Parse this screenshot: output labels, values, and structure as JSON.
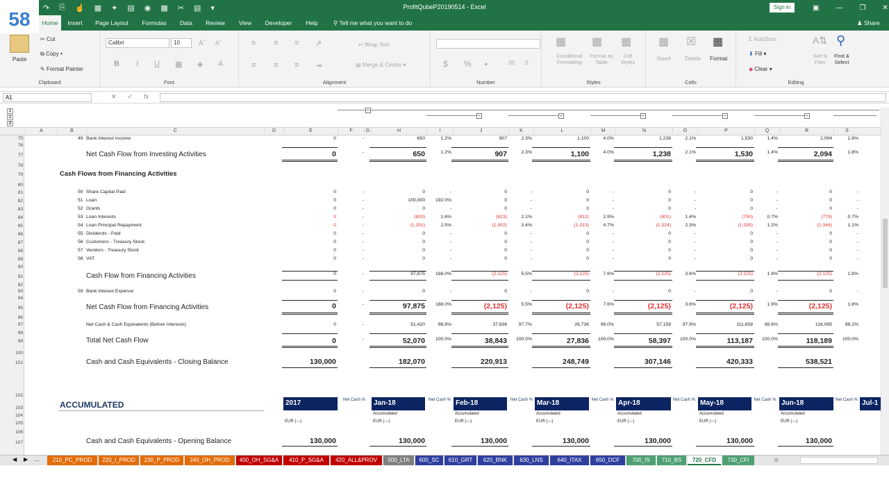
{
  "window": {
    "title": "ProfitQubeP20190514 - Excel",
    "signin": "Sign in",
    "share": "Share",
    "badge": "58"
  },
  "menu_tabs": [
    "Home",
    "Insert",
    "Page Layout",
    "Formulas",
    "Data",
    "Review",
    "View",
    "Developer",
    "Help"
  ],
  "tell_me": "Tell me what you want to do",
  "ribbon": {
    "clipboard": {
      "label": "Clipboard",
      "paste": "Paste",
      "cut": "Cut",
      "copy": "Copy",
      "format_painter": "Format Painter"
    },
    "font": {
      "label": "Font",
      "family": "Calibri",
      "size": "10"
    },
    "alignment": {
      "label": "Alignment",
      "wrap": "Wrap Text",
      "merge": "Merge & Center"
    },
    "number": {
      "label": "Number"
    },
    "styles": {
      "label": "Styles",
      "conditional": "Conditional Formatting",
      "format_table": "Format as Table",
      "cell_styles": "Cell Styles"
    },
    "cells": {
      "label": "Cells",
      "insert": "Insert",
      "delete": "Delete",
      "format": "Format"
    },
    "editing": {
      "label": "Editing",
      "autosum": "AutoSum",
      "fill": "Fill",
      "clear": "Clear",
      "sort": "Sort & Filter",
      "find": "Find & Select"
    }
  },
  "namebox": "A1",
  "columns": [
    "A",
    "B",
    "C",
    "D",
    "E",
    "F",
    "G",
    "H",
    "I",
    "J",
    "K",
    "L",
    "M",
    "N",
    "O",
    "P",
    "Q",
    "R",
    "S"
  ],
  "rows": {
    "r75": {
      "no": "75",
      "code": "49",
      "label": "Bank Interest Income",
      "e": "0",
      "f": "-",
      "h": "650",
      "i": "1.2%",
      "j": "907",
      "k": "2.3%",
      "l": "1,100",
      "m": "4.0%",
      "n": "1,238",
      "o": "2.1%",
      "p": "1,530",
      "q": "1.4%",
      "r": "2,094",
      "s": "1.8%"
    },
    "r77": {
      "no": "77",
      "label": "Net Cash Flow from Investing Activities",
      "e": "0",
      "f": "-",
      "h": "650",
      "i": "1.2%",
      "j": "907",
      "k": "2.3%",
      "l": "1,100",
      "m": "4.0%",
      "n": "1,238",
      "o": "2.1%",
      "p": "1,530",
      "q": "1.4%",
      "r": "2,094",
      "s": "1.8%"
    },
    "r79": {
      "no": "79",
      "label": "Cash Flows from Financing Activities"
    },
    "fin": [
      {
        "no": "81",
        "code": "50",
        "label": "Share Capital Paid",
        "e": "0",
        "f": "-",
        "h": "0",
        "i": "-",
        "j": "0",
        "k": "-",
        "l": "0",
        "m": "-",
        "n": "0",
        "o": "-",
        "p": "0",
        "q": "-",
        "r": "0",
        "s": "-"
      },
      {
        "no": "82",
        "code": "51",
        "label": "Loan",
        "e": "0",
        "f": "-",
        "h": "100,000",
        "i": "192.0%",
        "j": "0",
        "k": "-",
        "l": "0",
        "m": "-",
        "n": "0",
        "o": "-",
        "p": "0",
        "q": "-",
        "r": "0",
        "s": "-"
      },
      {
        "no": "83",
        "code": "52",
        "label": "Grants",
        "e": "0",
        "f": "-",
        "h": "0",
        "i": "-",
        "j": "0",
        "k": "-",
        "l": "0",
        "m": "-",
        "n": "0",
        "o": "-",
        "p": "0",
        "q": "-",
        "r": "0",
        "s": "-"
      },
      {
        "no": "84",
        "code": "53",
        "label": "Loan Interests",
        "e": "0",
        "f": "-",
        "h": "(833)",
        "i": "1.6%",
        "j": "(823)",
        "k": "2.1%",
        "l": "(812)",
        "m": "2.9%",
        "n": "(801)",
        "o": "1.4%",
        "p": "(790)",
        "q": "0.7%",
        "r": "(779)",
        "s": "0.7%",
        "neg": true
      },
      {
        "no": "85",
        "code": "54",
        "label": "Loan Principal Repayment",
        "e": "0",
        "f": "-",
        "h": "(1,291)",
        "i": "2.5%",
        "j": "(1,302)",
        "k": "3.4%",
        "l": "(1,313)",
        "m": "4.7%",
        "n": "(1,324)",
        "o": "2.3%",
        "p": "(1,335)",
        "q": "1.2%",
        "r": "(1,346)",
        "s": "1.1%",
        "neg": true
      },
      {
        "no": "86",
        "code": "55",
        "label": "Dividends - Paid",
        "e": "0",
        "f": "-",
        "h": "0",
        "i": "-",
        "j": "0",
        "k": "-",
        "l": "0",
        "m": "-",
        "n": "0",
        "o": "-",
        "p": "0",
        "q": "-",
        "r": "0",
        "s": "-"
      },
      {
        "no": "87",
        "code": "56",
        "label": "Customers - Treasury Stock",
        "e": "0",
        "f": "-",
        "h": "0",
        "i": "-",
        "j": "0",
        "k": "-",
        "l": "0",
        "m": "-",
        "n": "0",
        "o": "-",
        "p": "0",
        "q": "-",
        "r": "0",
        "s": "-"
      },
      {
        "no": "88",
        "code": "57",
        "label": "Vendors - Treasury Stock",
        "e": "0",
        "f": "-",
        "h": "0",
        "i": "-",
        "j": "0",
        "k": "-",
        "l": "0",
        "m": "-",
        "n": "0",
        "o": "-",
        "p": "0",
        "q": "-",
        "r": "0",
        "s": "-"
      },
      {
        "no": "89",
        "code": "58",
        "label": "VAT",
        "e": "0",
        "f": "-",
        "h": "0",
        "i": "-",
        "j": "0",
        "k": "-",
        "l": "0",
        "m": "-",
        "n": "0",
        "o": "-",
        "p": "0",
        "q": "-",
        "r": "0",
        "s": "-"
      }
    ],
    "r91": {
      "no": "91",
      "label": "Cash Flow from Financing Activities",
      "e": "0",
      "f": "-",
      "h": "97,875",
      "i": "188.0%",
      "j": "(2,125)",
      "k": "5.5%",
      "l": "(2,125)",
      "m": "7.6%",
      "n": "(2,125)",
      "o": "3.6%",
      "p": "(2,125)",
      "q": "1.9%",
      "r": "(2,125)",
      "s": "1.8%"
    },
    "r93": {
      "no": "93",
      "code": "59",
      "label": "Bank Interest Expense",
      "e": "0",
      "f": "-",
      "h": "0",
      "i": "-",
      "j": "0",
      "k": "-",
      "l": "0",
      "m": "-",
      "n": "0",
      "o": "-",
      "p": "0",
      "q": "-",
      "r": "0",
      "s": "-"
    },
    "r95": {
      "no": "95",
      "label": "Net Cash Flow from Financing Activities",
      "e": "0",
      "f": "-",
      "h": "97,875",
      "i": "188.0%",
      "j": "(2,125)",
      "k": "5.5%",
      "l": "(2,125)",
      "m": "7.6%",
      "n": "(2,125)",
      "o": "3.6%",
      "p": "(2,125)",
      "q": "1.9%",
      "r": "(2,125)",
      "s": "1.8%"
    },
    "r97": {
      "no": "97",
      "label": "Net Cash & Cash Equivalents (Before Interests)",
      "e": "0",
      "f": "-",
      "h": "51,420",
      "i": "98.8%",
      "j": "37,936",
      "k": "97.7%",
      "l": "26,736",
      "m": "96.0%",
      "n": "57,158",
      "o": "97.9%",
      "p": "111,658",
      "q": "98.6%",
      "r": "116,095",
      "s": "98.2%"
    },
    "r99": {
      "no": "99",
      "label": "Total Net Cash Flow",
      "e": "0",
      "f": "-",
      "h": "52,070",
      "i": "100.0%",
      "j": "38,843",
      "k": "100.0%",
      "l": "27,836",
      "m": "100.0%",
      "n": "58,397",
      "o": "100.0%",
      "p": "113,187",
      "q": "100.0%",
      "r": "118,189",
      "s": "100.0%"
    },
    "r101": {
      "no": "101",
      "label": "Cash and Cash Equivalents - Closing Balance",
      "e": "130,000",
      "h": "182,070",
      "j": "220,913",
      "l": "248,749",
      "n": "307,146",
      "p": "420,333",
      "r": "538,521"
    },
    "r103": {
      "no": "103",
      "label": "ACCUMULATED",
      "periods": [
        "2017",
        "Jan-18",
        "Feb-18",
        "Mar-18",
        "Apr-18",
        "May-18",
        "Jun-18",
        "Jul-1"
      ],
      "netcash": "Net Cash %",
      "accumulated": "Accumulated",
      "eur": "EUR (---)"
    },
    "r107": {
      "no": "107",
      "label": "Cash and Cash Equivalents - Opening Balance",
      "vals": [
        "130,000",
        "130,000",
        "130,000",
        "130,000",
        "130,000",
        "130,000",
        "130,000"
      ]
    }
  },
  "sheet_tabs": [
    {
      "name": "210_PC_PROD",
      "color": "#e36c0a"
    },
    {
      "name": "220_I_PROD",
      "color": "#e36c0a"
    },
    {
      "name": "230_P_PROD",
      "color": "#e36c0a"
    },
    {
      "name": "240_OH_PROD",
      "color": "#e36c0a"
    },
    {
      "name": "400_OH_SG&A",
      "color": "#c00000"
    },
    {
      "name": "410_P_SG&A",
      "color": "#c00000"
    },
    {
      "name": "420_ALL&PROV",
      "color": "#c00000"
    },
    {
      "name": "500_LTA",
      "color": "#7f7f7f"
    },
    {
      "name": "600_SC",
      "color": "#2f3f9f"
    },
    {
      "name": "610_GRT",
      "color": "#2f3f9f"
    },
    {
      "name": "620_BNK",
      "color": "#2f3f9f"
    },
    {
      "name": "630_LNS",
      "color": "#2f3f9f"
    },
    {
      "name": "640_ITAX",
      "color": "#2f3f9f"
    },
    {
      "name": "650_DCF",
      "color": "#2f3f9f"
    },
    {
      "name": "700_IS",
      "color": "#4ea072"
    },
    {
      "name": "710_BS",
      "color": "#4ea072"
    },
    {
      "name": "720_CFD",
      "color": "#ffffff"
    },
    {
      "name": "730_CFI",
      "color": "#4ea072"
    }
  ]
}
